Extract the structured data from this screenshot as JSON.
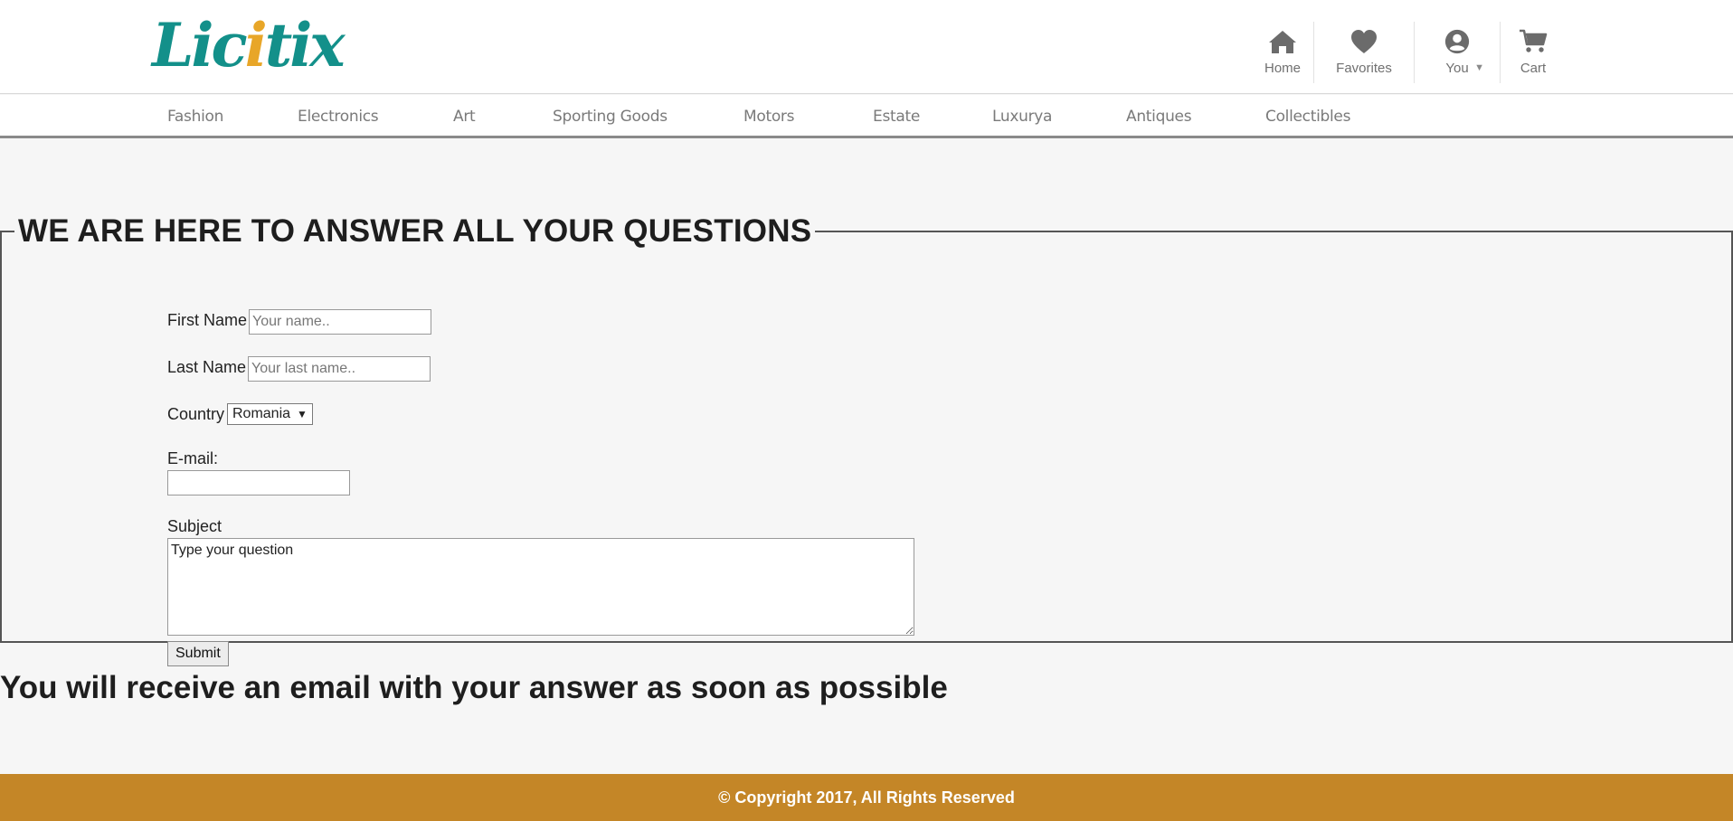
{
  "header": {
    "logo": {
      "before": "Lic",
      "accent": "i",
      "after": "tix"
    },
    "nav": {
      "home": "Home",
      "favorites": "Favorites",
      "you": "You",
      "cart": "Cart"
    }
  },
  "categories": [
    "Fashion",
    "Electronics",
    "Art",
    "Sporting Goods",
    "Motors",
    "Estate",
    "Luxurya",
    "Antiques",
    "Collectibles"
  ],
  "form": {
    "legend": "WE ARE HERE TO ANSWER ALL YOUR QUESTIONS",
    "first_name": {
      "label": "First Name",
      "placeholder": "Your name..",
      "value": ""
    },
    "last_name": {
      "label": "Last Name",
      "placeholder": "Your last name..",
      "value": ""
    },
    "country": {
      "label": "Country",
      "selected": "Romania"
    },
    "email": {
      "label": "E-mail:",
      "value": ""
    },
    "subject": {
      "label": "Subject",
      "value": "Type your question"
    },
    "submit_label": "Submit"
  },
  "note": "You will receive an email with your answer as soon as possible",
  "footer": {
    "copyright": "© Copyright 2017, All Rights Reserved"
  },
  "colors": {
    "brand_teal": "#13908a",
    "logo_accent": "#e8a628",
    "footer_bg": "#c48627"
  },
  "icons": [
    "house-icon",
    "heart-icon",
    "user-circle-icon",
    "cart-icon",
    "caret-down-icon"
  ]
}
